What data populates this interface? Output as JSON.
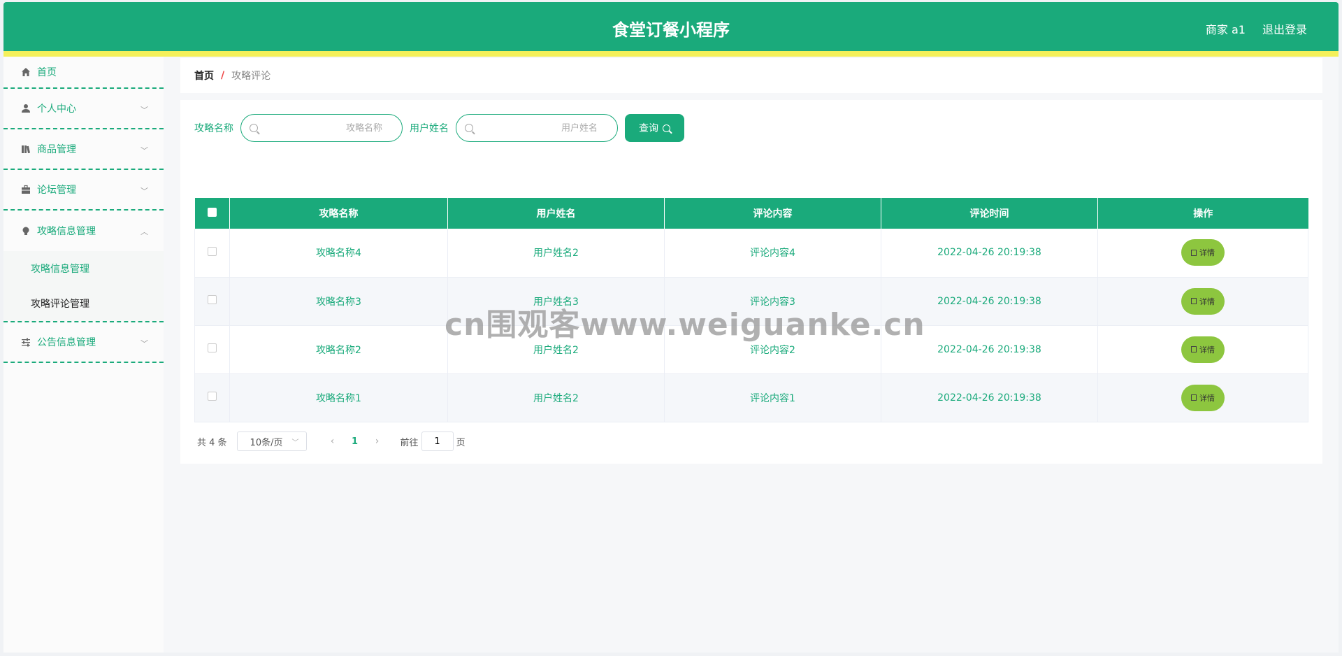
{
  "header": {
    "title": "食堂订餐小程序",
    "user_label": "商家 a1",
    "logout_label": "退出登录"
  },
  "sidebar": {
    "items": [
      {
        "label": "首页",
        "icon": "home-icon"
      },
      {
        "label": "个人中心",
        "icon": "user-icon"
      },
      {
        "label": "商品管理",
        "icon": "books-icon"
      },
      {
        "label": "论坛管理",
        "icon": "briefcase-icon"
      },
      {
        "label": "攻略信息管理",
        "icon": "bulb-icon",
        "subitems": [
          "攻略信息管理",
          "攻略评论管理"
        ]
      },
      {
        "label": "公告信息管理",
        "icon": "sliders-icon"
      }
    ]
  },
  "breadcrumb": {
    "home": "首页",
    "separator": "/",
    "current": "攻略评论"
  },
  "search": {
    "field1_label": "攻略名称",
    "field1_placeholder": "攻略名称",
    "field2_label": "用户姓名",
    "field2_placeholder": "用户姓名",
    "query_label": "查询"
  },
  "table": {
    "columns": [
      "攻略名称",
      "用户姓名",
      "评论内容",
      "评论时间",
      "操作"
    ],
    "rows": [
      [
        "攻略名称4",
        "用户姓名2",
        "评论内容4",
        "2022-04-26 20:19:38"
      ],
      [
        "攻略名称3",
        "用户姓名3",
        "评论内容3",
        "2022-04-26 20:19:38"
      ],
      [
        "攻略名称2",
        "用户姓名2",
        "评论内容2",
        "2022-04-26 20:19:38"
      ],
      [
        "攻略名称1",
        "用户姓名2",
        "评论内容1",
        "2022-04-26 20:19:38"
      ]
    ],
    "detail_label": "详情"
  },
  "pagination": {
    "total": "共 4 条",
    "page_size": "10条/页",
    "current_page": "1",
    "goto_label": "前往",
    "goto_value": "1",
    "page_suffix": "页"
  },
  "watermark": "cn围观客www.weiguanke.cn",
  "colors": {
    "primary": "#1aaa7b",
    "accent_yellow": "#f4f05a",
    "detail_button": "#8dc63f"
  }
}
